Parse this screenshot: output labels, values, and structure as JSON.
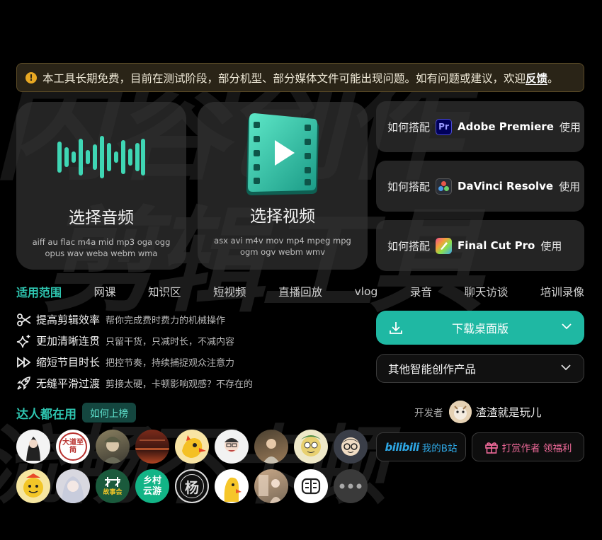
{
  "notice": {
    "text": "本工具长期免费，目前在测试阶段，部分机型、部分媒体文件可能出现问题。如有问题或建议，欢迎",
    "link": "反馈",
    "end": "。"
  },
  "cards": [
    {
      "title": "选择音频",
      "formats": "aiff au flac m4a mid mp3 oga ogg opus wav weba webm wma",
      "icon": "audio-waveform-icon"
    },
    {
      "title": "选择视频",
      "formats": "asx avi m4v mov mp4 mpeg mpg ogm ogv webm wmv",
      "icon": "video-film-icon"
    }
  ],
  "howto": [
    {
      "prefix": "如何搭配",
      "app": "Adobe Premiere",
      "suffix": "使用",
      "icon_text": "Pr"
    },
    {
      "prefix": "如何搭配",
      "app": "DaVinci Resolve",
      "suffix": "使用"
    },
    {
      "prefix": "如何搭配",
      "app": "Final Cut Pro",
      "suffix": "使用"
    }
  ],
  "scope": {
    "label": "适用范围",
    "items": [
      "网课",
      "知识区",
      "短视频",
      "直播回放",
      "vlog",
      "录音",
      "聊天访谈",
      "培训录像"
    ]
  },
  "features": [
    {
      "title": "提高剪辑效率",
      "desc": "帮你完成费时费力的机械操作",
      "icon": "scissors-icon"
    },
    {
      "title": "更加清晰连贯",
      "desc": "只留干货，只减时长，不减内容",
      "icon": "sparkle-icon"
    },
    {
      "title": "缩短节目时长",
      "desc": "把控节奏，持续捕捉观众注意力",
      "icon": "fast-forward-icon"
    },
    {
      "title": "无缝平滑过渡",
      "desc": "剪接太硬，卡顿影响观感？不存在的",
      "icon": "rocket-icon"
    }
  ],
  "download": {
    "label": "下载桌面版"
  },
  "other": {
    "label": "其他智能创作产品"
  },
  "users": {
    "title": "达人都在用",
    "button": "如何上榜"
  },
  "avatar_text": {
    "a2": "大道至简",
    "a12": "故事会",
    "a13": "乡村云游",
    "a14": "杨"
  },
  "developer": {
    "label": "开发者",
    "name": "渣渣就是玩儿"
  },
  "social": {
    "bili_logo": "bilibili",
    "bili": "我的B站",
    "tip": "打赏作者 领福利"
  },
  "bg_text": [
    "内容创作",
    "剪辑工具",
    "流畅不卡顿"
  ],
  "colors": {
    "accent": "#1fb8a3",
    "teal_text": "#2ec5b0",
    "warning": "#e8a823"
  }
}
